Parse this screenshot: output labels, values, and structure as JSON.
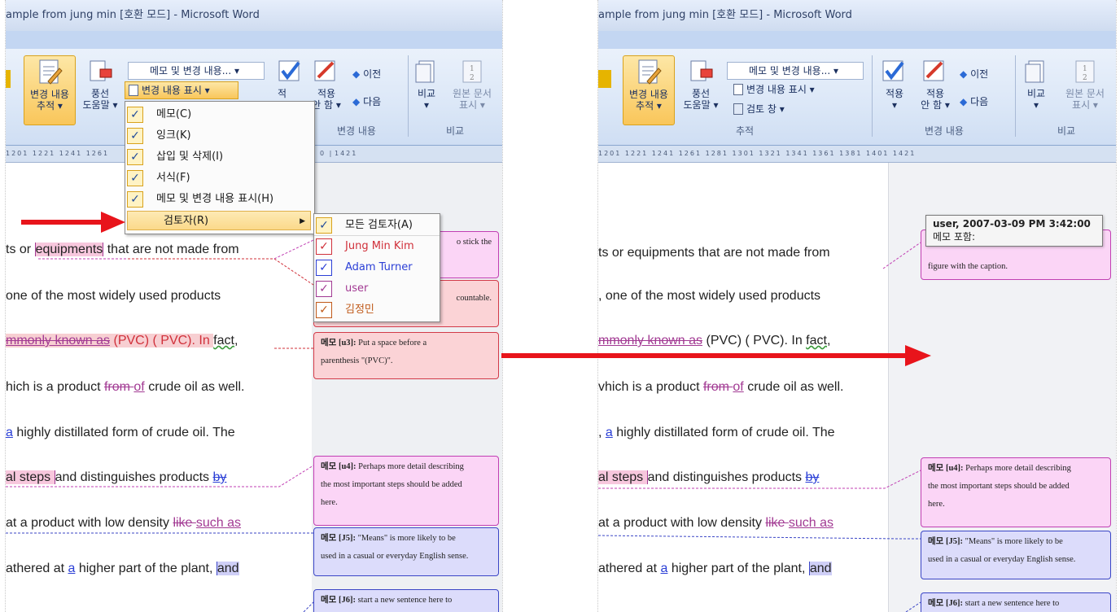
{
  "left": {
    "title": "ample from jung min [호환 모드] - Microsoft Word",
    "ribbon": {
      "track_changes": "변경 내용",
      "track_changes_sub": "추적 ▾",
      "balloons": "풍선",
      "balloons_sub": "도움말 ▾",
      "markup_dropdown": "메모 및 변경 내용... ▾",
      "show_markup": "변경 내용 표시 ▾",
      "accept": "적용",
      "accept_partial": "적",
      "reject": "적용",
      "reject_sub": "안 함 ▾",
      "previous": "이전",
      "next": "다음",
      "changes_group": "변경 내용",
      "compare": "비교",
      "compare_sub": "▾",
      "show_source": "원본 문서",
      "show_source_sub": "표시 ▾",
      "compare_group": "비교"
    },
    "ruler": "1201  1221  1241  1261",
    "ruler_right": "1421",
    "ruler_mid": "0 |",
    "menu": {
      "items": [
        {
          "label": "메모(C)",
          "checked": true
        },
        {
          "label": "잉크(K)",
          "checked": true
        },
        {
          "label": "삽입 및 삭제(I)",
          "checked": true
        },
        {
          "label": "서식(F)",
          "checked": true
        },
        {
          "label": "메모 및 변경 내용 표시(H)",
          "checked": true
        },
        {
          "label": "검토자(R)",
          "checked": false,
          "has_submenu": true
        }
      ],
      "submenu_arrow": "▶"
    },
    "submenu": {
      "items": [
        {
          "label": "모든 검토자(A)",
          "checked": true,
          "color": "#1a1a1a"
        },
        {
          "label": "Jung Min Kim",
          "checked": true,
          "color": "#d0303a"
        },
        {
          "label": "Adam Turner",
          "checked": true,
          "color": "#2b3fd6"
        },
        {
          "label": "user",
          "checked": true,
          "color": "#a23a93"
        },
        {
          "label": "김정민",
          "checked": true,
          "color": "#c05a1a"
        }
      ]
    },
    "lines": {
      "l1a": "ts or ",
      "l1b": "equipments",
      "l1c": " that are not made from",
      "l2": " one of the most widely used products",
      "l3a": "mmonly known as",
      "l3b": " (PVC) ( PVC). In ",
      "l3c": "fact",
      "l3d": ",",
      "l4a": "hich is a product ",
      "l4b": "from ",
      "l4c": "of",
      "l4d": " crude oil as well.",
      "l5a": " ",
      "l5b": "a",
      "l5c": " highly distillated form of crude oil. The",
      "l6a": "al  steps  ",
      "l6b": "and  distinguishes  products  ",
      "l6c": "by",
      "l7a": "at a product with low density ",
      "l7b": "like ",
      "l7c": "such as",
      "l8a": "athered at ",
      "l8b": "a",
      "l8c": " higher part of the plant, ",
      "l8d": "and"
    },
    "balloons": {
      "b1": "o stick the",
      "b2": "countable.",
      "b3_head": "메모 [u3]:",
      "b3_body": " Put a space before a",
      "b3_body2": "parenthesis \"(PVC)\".",
      "b4_head": "메모 [u4]:",
      "b4_body": " Perhaps more detail describing",
      "b4_body2": "the most important steps should be added",
      "b4_body3": "here.",
      "b5_head": "메모 [J5]:",
      "b5_body": " \"Means\" is more likely to be",
      "b5_body2": "used in a casual or everyday English sense.",
      "b6_head": "메모 [J6]:",
      "b6_body": " start a new sentence here to"
    }
  },
  "right": {
    "title": "ample from jung min [호환 모드] - Microsoft Word",
    "ribbon": {
      "track_changes": "변경 내용",
      "track_changes_sub": "추적 ▾",
      "balloons": "풍선",
      "balloons_sub": "도움말 ▾",
      "markup_dropdown": "메모 및 변경 내용... ▾",
      "show_markup": "변경 내용 표시 ▾",
      "review_pane": "검토 창 ▾",
      "tracking_group": "추적",
      "accept": "적용",
      "accept_sub": "▾",
      "reject": "적용",
      "reject_sub": "안 함 ▾",
      "previous": "이전",
      "next": "다음",
      "changes_group": "변경 내용",
      "compare": "비교",
      "compare_sub": "▾",
      "show_source": "원본 문서",
      "show_source_sub": "표시 ▾",
      "compare_group": "비교"
    },
    "ruler": "1201  1221  1241  1261  1281  1301  1321  1341  1361  1381  1401  1421",
    "tooltip_head": "user, 2007-03-09 PM 3:42:00",
    "tooltip_body": "메모 포함:",
    "lines": {
      "l1": "ts or equipments that are not made from",
      "l2": ", one of the most widely used products",
      "l3a": "mmonly known as",
      "l3b": " (PVC) ( PVC). In ",
      "l3c": "fact",
      "l3d": ",",
      "l4a": "vhich is a product ",
      "l4b": "from ",
      "l4c": "of",
      "l4d": " crude oil as well.",
      "l5a": ", ",
      "l5b": "a",
      "l5c": " highly distillated form of crude oil. The",
      "l6a": "al  steps  ",
      "l6b": "and  distinguishes  products  ",
      "l6c": "by",
      "l7a": "at a product with low density ",
      "l7b": "like ",
      "l7c": "such as",
      "l8a": "athered at ",
      "l8b": "a",
      "l8c": " higher part of the plant, ",
      "l8d": "and"
    },
    "balloons": {
      "b1": "figure with the caption.",
      "b4_head": "메모 [u4]:",
      "b4_body": " Perhaps more detail describing",
      "b4_body2": "the most important steps should be added",
      "b4_body3": "here.",
      "b5_head": "메모 [J5]:",
      "b5_body": " \"Means\" is more likely to be",
      "b5_body2": "used in a casual or everyday English sense.",
      "b6_head": "메모 [J6]:",
      "b6_body": " start a new sentence here to"
    }
  },
  "colors": {
    "arrow": "#e8141b",
    "menu_highlight": "#fbd98a",
    "ribbon_bg": "#dbe7f7"
  }
}
